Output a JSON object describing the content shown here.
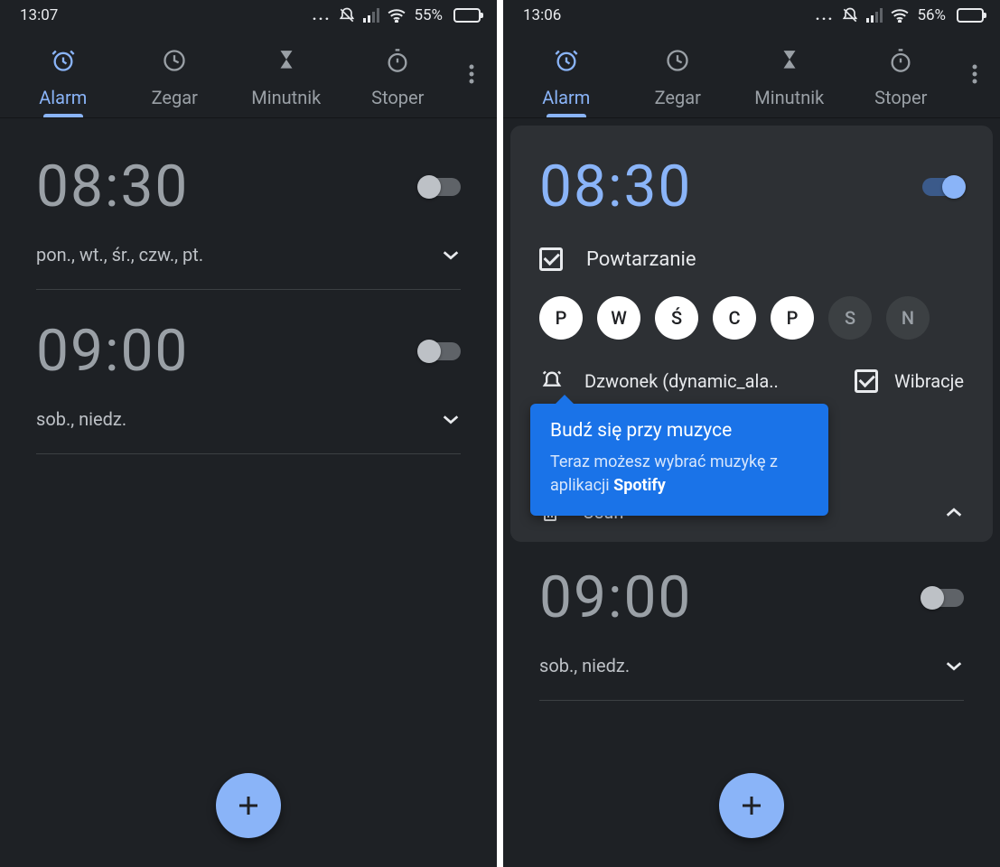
{
  "colors": {
    "accent": "#8ab4f8",
    "bg": "#1e2125",
    "card": "#2d3034",
    "tip": "#1a73e8"
  },
  "left": {
    "status": {
      "time": "13:07",
      "battery_pct": "55%",
      "battery_fill": 55
    },
    "tabs": {
      "alarm": "Alarm",
      "clock": "Zegar",
      "timer": "Minutnik",
      "stopwatch": "Stoper",
      "active": "alarm"
    },
    "alarm1": {
      "time": "08:30",
      "enabled": false,
      "sub": "pon., wt., śr., czw., pt."
    },
    "alarm2": {
      "time": "09:00",
      "enabled": false,
      "sub": "sob., niedz."
    }
  },
  "right": {
    "status": {
      "time": "13:06",
      "battery_pct": "56%",
      "battery_fill": 56
    },
    "tabs": {
      "alarm": "Alarm",
      "clock": "Zegar",
      "timer": "Minutnik",
      "stopwatch": "Stoper",
      "active": "alarm"
    },
    "expanded": {
      "time": "08:30",
      "enabled": true,
      "repeat_label": "Powtarzanie",
      "repeat_checked": true,
      "days": [
        {
          "l": "P",
          "on": true
        },
        {
          "l": "W",
          "on": true
        },
        {
          "l": "Ś",
          "on": true
        },
        {
          "l": "C",
          "on": true
        },
        {
          "l": "P",
          "on": true
        },
        {
          "l": "S",
          "on": false
        },
        {
          "l": "N",
          "on": false
        }
      ],
      "ringtone_label": "Dzwonek (dynamic_ala..",
      "vibrate_label": "Wibracje",
      "vibrate_checked": true,
      "delete_label": "Usuń",
      "tip_title": "Budź się przy muzyce",
      "tip_body_pre": "Teraz możesz wybrać muzykę z aplikacji ",
      "tip_body_bold": "Spotify"
    },
    "alarm2": {
      "time": "09:00",
      "enabled": false,
      "sub": "sob., niedz."
    }
  }
}
